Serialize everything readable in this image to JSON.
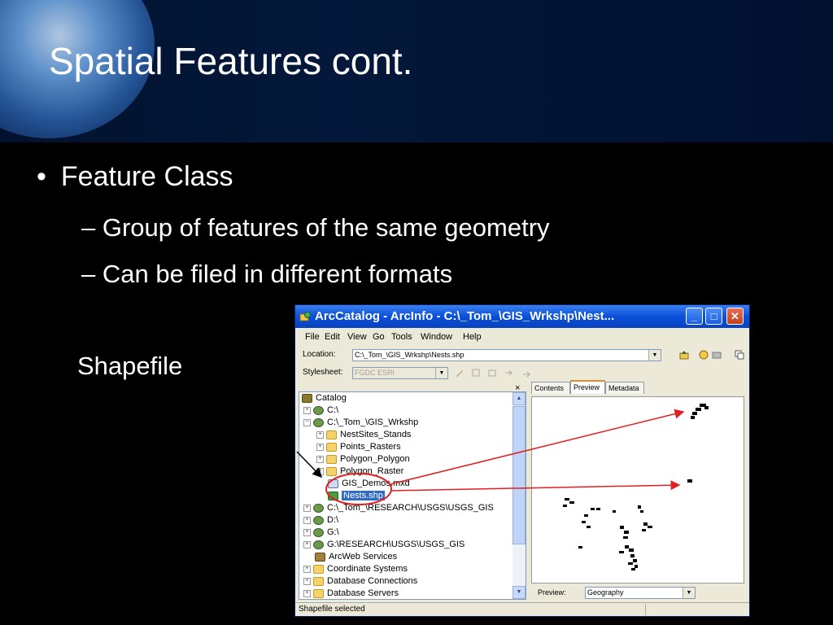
{
  "slide": {
    "title": "Spatial Features cont.",
    "bullet": "Feature Class",
    "subbullets": [
      "– Group of features of the same geometry",
      "– Can be filed in different formats"
    ],
    "bullet_symbol": "•",
    "label": "Shapefile"
  },
  "window": {
    "title": "ArcCatalog - ArcInfo - C:\\_Tom_\\GIS_Wrkshp\\Nest...",
    "controls": {
      "minimize": "_",
      "maximize": "□",
      "close": "✕"
    },
    "menu": [
      "File",
      "Edit",
      "View",
      "Go",
      "Tools",
      "Window",
      "Help"
    ],
    "location_label": "Location:",
    "location_value": "C:\\_Tom_\\GIS_Wrkshp\\Nests.shp",
    "stylesheet_label": "Stylesheet:",
    "stylesheet_value": "FGDC ESRI",
    "tree": [
      {
        "label": "Catalog",
        "expander": "",
        "icon": "catalog-icon"
      },
      {
        "label": "C:\\",
        "expander": "+",
        "icon": "drive-icon"
      },
      {
        "label": "C:\\_Tom_\\GIS_Wrkshp",
        "expander": "−",
        "icon": "drive-icon"
      },
      {
        "label": "NestSites_Stands",
        "expander": "+",
        "icon": "folder-icon"
      },
      {
        "label": "Points_Rasters",
        "expander": "+",
        "icon": "folder-icon"
      },
      {
        "label": "Polygon_Polygon",
        "expander": "+",
        "icon": "folder-icon"
      },
      {
        "label": "Polygon_Raster",
        "expander": "+",
        "icon": "folder-icon"
      },
      {
        "label": "GIS_Demos.mxd",
        "expander": "",
        "icon": "map-document-icon"
      },
      {
        "label": "Nests.shp",
        "expander": "",
        "icon": "shapefile-icon"
      },
      {
        "label": "C:\\_Tom_\\RESEARCH\\USGS\\USGS_GIS",
        "expander": "+",
        "icon": "drive-icon"
      },
      {
        "label": "D:\\",
        "expander": "+",
        "icon": "drive-icon"
      },
      {
        "label": "G:\\",
        "expander": "+",
        "icon": "drive-icon"
      },
      {
        "label": "G:\\RESEARCH\\USGS\\USGS_GIS",
        "expander": "+",
        "icon": "drive-icon"
      },
      {
        "label": "ArcWeb Services",
        "expander": "",
        "icon": "arcweb-icon"
      },
      {
        "label": "Coordinate Systems",
        "expander": "+",
        "icon": "folder-icon"
      },
      {
        "label": "Database Connections",
        "expander": "+",
        "icon": "folder-icon"
      },
      {
        "label": "Database Servers",
        "expander": "+",
        "icon": "folder-icon"
      }
    ],
    "selected_item": "Nests.shp",
    "tabs": [
      "Contents",
      "Preview",
      "Metadata"
    ],
    "active_tab": "Preview",
    "preview_label": "Preview:",
    "preview_value": "Geography",
    "status": "Shapefile selected",
    "scroll_up": "▲",
    "scroll_down": "▼",
    "combo_arrow": "▼",
    "pane_close": "×"
  },
  "colors": {
    "annotation_red": "#e02020",
    "selection_blue": "#316ac5",
    "title_blue": "#0a4fd8"
  }
}
